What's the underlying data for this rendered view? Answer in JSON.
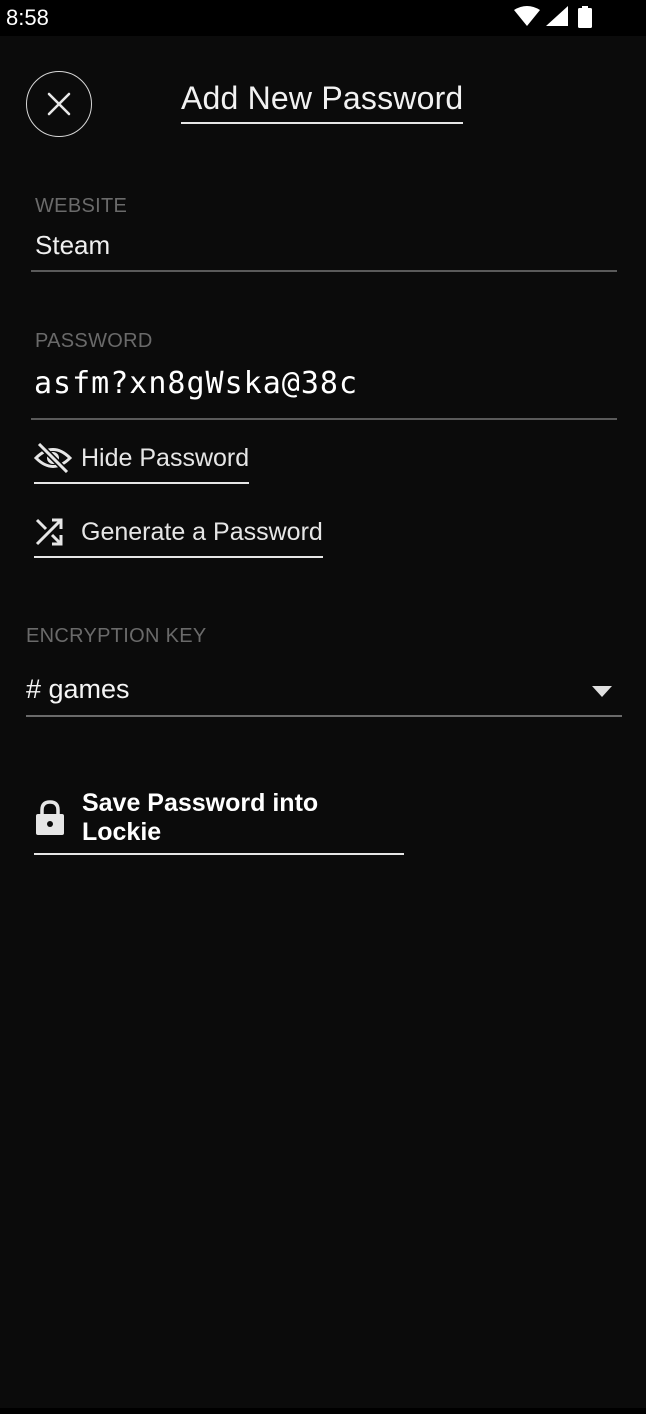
{
  "status_bar": {
    "time": "8:58"
  },
  "header": {
    "title": "Add New Password"
  },
  "website": {
    "label": "WEBSITE",
    "value": "Steam"
  },
  "password": {
    "label": "PASSWORD",
    "value": "asfm?xn8gWska@38c"
  },
  "actions": {
    "hide_password": "Hide Password",
    "generate_password": "Generate a Password"
  },
  "encryption_key": {
    "label": "ENCRYPTION KEY",
    "selected": "# games"
  },
  "save": {
    "label": "Save Password into Lockie"
  },
  "icons": {
    "close": "close-icon",
    "hide": "eye-off-icon",
    "generate": "shuffle-icon",
    "dropdown": "dropdown-arrow-icon",
    "save": "lock-icon"
  }
}
